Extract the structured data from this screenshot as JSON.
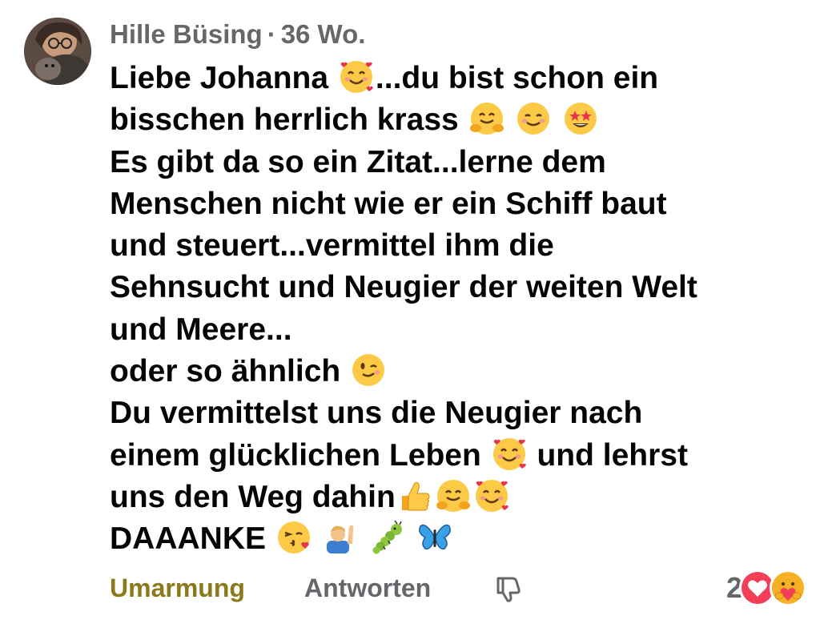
{
  "comment": {
    "author": "Hille Büsing",
    "separator": "·",
    "time": "36 Wo.",
    "lines": [
      [
        {
          "t": "Liebe Johanna "
        },
        {
          "e": "smiling-face-with-hearts-icon"
        },
        {
          "t": "...du bist schon ein"
        }
      ],
      [
        {
          "t": "bisschen herrlich krass "
        },
        {
          "e": "hugging-face-icon"
        },
        {
          "t": " "
        },
        {
          "e": "smiling-face-icon"
        },
        {
          "t": " "
        },
        {
          "e": "star-struck-icon"
        }
      ],
      [
        {
          "t": "Es gibt da  so ein Zitat...lerne dem"
        }
      ],
      [
        {
          "t": "Menschen nicht wie er ein Schiff baut"
        }
      ],
      [
        {
          "t": "und steuert...vermittel ihm die"
        }
      ],
      [
        {
          "t": "Sehnsucht und Neugier der weiten Welt"
        }
      ],
      [
        {
          "t": "und Meere..."
        }
      ],
      [
        {
          "t": "oder so ähnlich "
        },
        {
          "e": "winking-face-icon"
        }
      ],
      [
        {
          "t": "Du vermittelst uns die Neugier nach"
        }
      ],
      [
        {
          "t": "einem glücklichen Leben "
        },
        {
          "e": "smiling-face-with-hearts-icon"
        },
        {
          "t": " und lehrst"
        }
      ],
      [
        {
          "t": "uns den Weg dahin"
        },
        {
          "e": "thumbs-up-icon"
        },
        {
          "e": "hugging-face-icon"
        },
        {
          "e": "smiling-face-with-hearts-icon"
        }
      ],
      [
        {
          "t": "DAAANKE "
        },
        {
          "e": "face-blowing-kiss-icon"
        },
        {
          "t": " "
        },
        {
          "e": "person-raising-hand-icon"
        },
        {
          "t": " "
        },
        {
          "e": "caterpillar-icon"
        },
        {
          "t": " "
        },
        {
          "e": "butterfly-icon"
        }
      ]
    ]
  },
  "actions": {
    "hug_label": "Umarmung",
    "reply_label": "Antworten",
    "dislike_icon": "thumbs-down-icon",
    "reaction_count": "2",
    "reaction_icons": [
      "love-heart-icon",
      "care-hug-icon"
    ]
  },
  "colors": {
    "hug_active": "#8b7a1c",
    "meta_gray": "#65676b",
    "text": "#050505",
    "love": "#f33e58"
  }
}
